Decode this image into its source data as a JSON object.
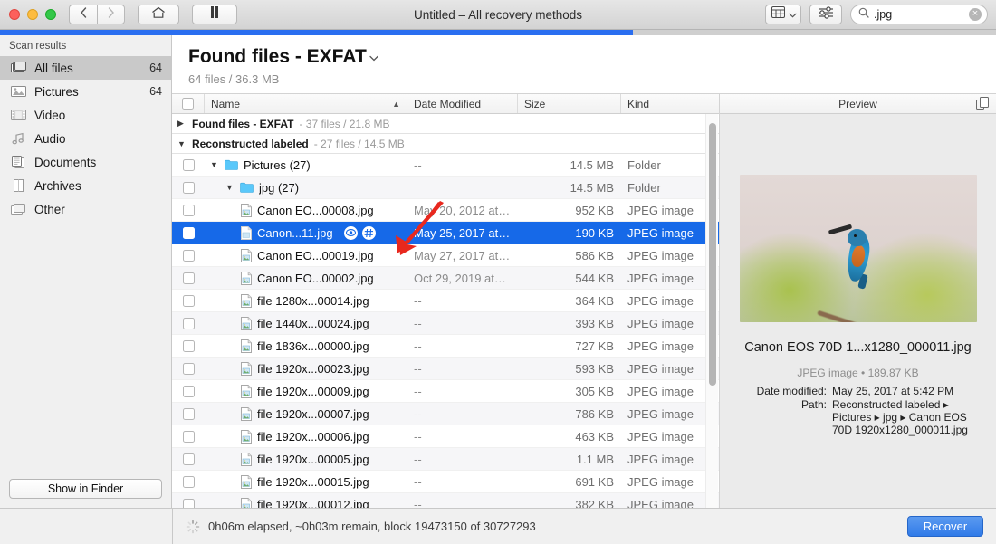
{
  "window": {
    "title": "Untitled – All recovery methods",
    "progress_percent": 63.5
  },
  "toolbar": {
    "back_icon": "chevron-left-icon",
    "forward_icon": "chevron-right-icon",
    "home_icon": "home-icon",
    "pause_icon": "pause-icon",
    "view_icon": "grid-view-icon",
    "view_chevron": "chevron-down-icon",
    "filter_icon": "sliders-icon",
    "search_icon": "search-icon",
    "search_value": ".jpg",
    "search_placeholder": "Search",
    "clear_icon": "clear-circle-icon"
  },
  "sidebar": {
    "title": "Scan results",
    "items": [
      {
        "label": "All files",
        "count": "64",
        "icon": "all-files-icon",
        "active": true
      },
      {
        "label": "Pictures",
        "count": "64",
        "icon": "pictures-icon",
        "active": false
      },
      {
        "label": "Video",
        "count": "",
        "icon": "video-icon",
        "active": false
      },
      {
        "label": "Audio",
        "count": "",
        "icon": "audio-icon",
        "active": false
      },
      {
        "label": "Documents",
        "count": "",
        "icon": "documents-icon",
        "active": false
      },
      {
        "label": "Archives",
        "count": "",
        "icon": "archives-icon",
        "active": false
      },
      {
        "label": "Other",
        "count": "",
        "icon": "other-icon",
        "active": false
      }
    ],
    "show_in_finder": "Show in Finder"
  },
  "main": {
    "title": "Found files - EXFAT",
    "title_chevron": "chevron-down-icon",
    "subtitle": "64 files / 36.3 MB"
  },
  "table": {
    "columns": {
      "name": "Name",
      "date_modified": "Date Modified",
      "size": "Size",
      "kind": "Kind"
    },
    "sort_caret": "sort-ascending-caret",
    "groups": [
      {
        "name": "Found files - EXFAT",
        "meta": "- 37 files / 21.8 MB",
        "expanded": false
      },
      {
        "name": "Reconstructed labeled",
        "meta": "- 27 files / 14.5 MB",
        "expanded": true
      }
    ],
    "rows": [
      {
        "name": "Pictures (27)",
        "date": "--",
        "size": "14.5 MB",
        "kind": "Folder",
        "indent": 1,
        "type": "folder",
        "expanded": true,
        "selected": false,
        "alt": false
      },
      {
        "name": "jpg (27)",
        "date": "",
        "size": "14.5 MB",
        "kind": "Folder",
        "indent": 2,
        "type": "folder",
        "expanded": true,
        "selected": false,
        "alt": true
      },
      {
        "name": "Canon EO...00008.jpg",
        "date": "May 20, 2012 at…",
        "size": "952 KB",
        "kind": "JPEG image",
        "indent": 3,
        "type": "file",
        "expanded": false,
        "selected": false,
        "alt": false
      },
      {
        "name": "Canon...11.jpg",
        "date": "May 25, 2017 at…",
        "size": "190 KB",
        "kind": "JPEG image",
        "indent": 3,
        "type": "file",
        "expanded": false,
        "selected": true,
        "alt": false
      },
      {
        "name": "Canon EO...00019.jpg",
        "date": "May 27, 2017 at…",
        "size": "586 KB",
        "kind": "JPEG image",
        "indent": 3,
        "type": "file",
        "expanded": false,
        "selected": false,
        "alt": false
      },
      {
        "name": "Canon EO...00002.jpg",
        "date": "Oct 29, 2019 at…",
        "size": "544 KB",
        "kind": "JPEG image",
        "indent": 3,
        "type": "file",
        "expanded": false,
        "selected": false,
        "alt": true
      },
      {
        "name": "file 1280x...00014.jpg",
        "date": "--",
        "size": "364 KB",
        "kind": "JPEG image",
        "indent": 3,
        "type": "file",
        "expanded": false,
        "selected": false,
        "alt": false
      },
      {
        "name": "file 1440x...00024.jpg",
        "date": "--",
        "size": "393 KB",
        "kind": "JPEG image",
        "indent": 3,
        "type": "file",
        "expanded": false,
        "selected": false,
        "alt": true
      },
      {
        "name": "file 1836x...00000.jpg",
        "date": "--",
        "size": "727 KB",
        "kind": "JPEG image",
        "indent": 3,
        "type": "file",
        "expanded": false,
        "selected": false,
        "alt": false
      },
      {
        "name": "file 1920x...00023.jpg",
        "date": "--",
        "size": "593 KB",
        "kind": "JPEG image",
        "indent": 3,
        "type": "file",
        "expanded": false,
        "selected": false,
        "alt": true
      },
      {
        "name": "file 1920x...00009.jpg",
        "date": "--",
        "size": "305 KB",
        "kind": "JPEG image",
        "indent": 3,
        "type": "file",
        "expanded": false,
        "selected": false,
        "alt": false
      },
      {
        "name": "file 1920x...00007.jpg",
        "date": "--",
        "size": "786 KB",
        "kind": "JPEG image",
        "indent": 3,
        "type": "file",
        "expanded": false,
        "selected": false,
        "alt": true
      },
      {
        "name": "file 1920x...00006.jpg",
        "date": "--",
        "size": "463 KB",
        "kind": "JPEG image",
        "indent": 3,
        "type": "file",
        "expanded": false,
        "selected": false,
        "alt": false
      },
      {
        "name": "file 1920x...00005.jpg",
        "date": "--",
        "size": "1.1 MB",
        "kind": "JPEG image",
        "indent": 3,
        "type": "file",
        "expanded": false,
        "selected": false,
        "alt": true
      },
      {
        "name": "file 1920x...00015.jpg",
        "date": "--",
        "size": "691 KB",
        "kind": "JPEG image",
        "indent": 3,
        "type": "file",
        "expanded": false,
        "selected": false,
        "alt": false
      },
      {
        "name": "file 1920x...00012.jpg",
        "date": "--",
        "size": "382 KB",
        "kind": "JPEG image",
        "indent": 3,
        "type": "file",
        "expanded": false,
        "selected": false,
        "alt": true
      }
    ],
    "selected_row_icons": [
      "quick-look-eye-icon",
      "info-hash-icon"
    ]
  },
  "preview": {
    "header": "Preview",
    "copy_icon": "duplicate-icon",
    "image_alt": "kingfisher-bird-photo",
    "filename": "Canon EOS 70D 1...x1280_000011.jpg",
    "kind_size": "JPEG image • 189.87 KB",
    "fields": [
      {
        "key": "Date modified:",
        "value": "May 25, 2017 at 5:42 PM"
      },
      {
        "key": "Path:",
        "value": "Reconstructed labeled ▸ Pictures ▸ jpg ▸ Canon EOS 70D 1920x1280_000011.jpg"
      }
    ]
  },
  "status": {
    "spinner_icon": "loading-spinner-icon",
    "text": "0h06m elapsed, ~0h03m remain, block 19473150 of 30727293",
    "recover_label": "Recover"
  },
  "annotation": {
    "arrow_icon": "red-arrow-pointer"
  },
  "colors": {
    "accent_blue": "#1669e8",
    "progress_blue": "#2a6ef0",
    "sidebar_bg": "#f0f0f0",
    "arrow_red": "#e8281e"
  }
}
